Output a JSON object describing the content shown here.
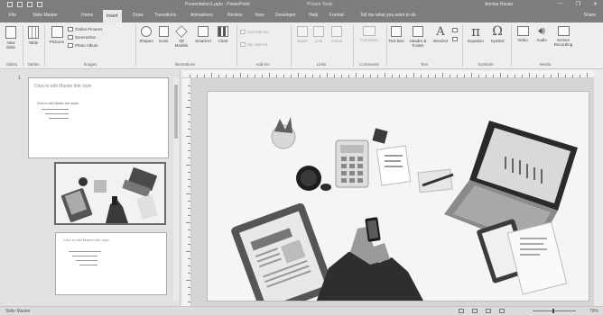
{
  "window": {
    "title": "Presentation1.pptx - PowerPoint",
    "context_label": "Picture Tools",
    "user": "Annisa Hasan",
    "controls": [
      "—",
      "❐",
      "✕"
    ]
  },
  "tabs": [
    {
      "label": "File"
    },
    {
      "label": "Slide Master"
    },
    {
      "label": "Home"
    },
    {
      "label": "Insert",
      "active": true
    },
    {
      "label": "Draw"
    },
    {
      "label": "Transitions"
    },
    {
      "label": "Animations"
    },
    {
      "label": "Review"
    },
    {
      "label": "View"
    },
    {
      "label": "Developer"
    },
    {
      "label": "Help"
    },
    {
      "label": "Format"
    }
  ],
  "tell_me": "Tell me what you want to do",
  "share": "Share",
  "ribbon": {
    "new_slide": "New Slide",
    "table": "Table",
    "pictures": "Pictures",
    "online_pictures": "Online Pictures",
    "screenshot": "Screenshot",
    "photo_album": "Photo Album",
    "shapes": "Shapes",
    "icons": "Icons",
    "models_3d": "3D Models",
    "smartart": "SmartArt",
    "chart": "Chart",
    "get_addins": "Get Add-ins",
    "my_addins": "My Add-ins",
    "zoom": "Zoom",
    "link": "Link",
    "action": "Action",
    "comment": "Comment",
    "text_box": "Text Box",
    "header_footer": "Header & Footer",
    "wordart": "WordArt",
    "equation": "Equation",
    "symbol": "Symbol",
    "video": "Video",
    "audio": "Audio",
    "screen_recording": "Screen Recording",
    "groups": {
      "slides": "Slides",
      "tables": "Tables",
      "images": "Images",
      "illustrations": "Illustrations",
      "addins": "Add-ins",
      "links": "Links",
      "comments": "Comments",
      "text": "Text",
      "symbols": "Symbols",
      "media": "Media"
    }
  },
  "left_pane": {
    "slide_number": "1",
    "title_placeholder": "Click to edit Master title style",
    "text_placeholder": "Click to edit Master text styles"
  },
  "status": {
    "view_label": "Slide Master",
    "zoom": "79%"
  },
  "colors": {
    "titlebar": "#7d7d7d",
    "ribbon": "#eeeeee",
    "workspace": "#d5d5d5"
  }
}
